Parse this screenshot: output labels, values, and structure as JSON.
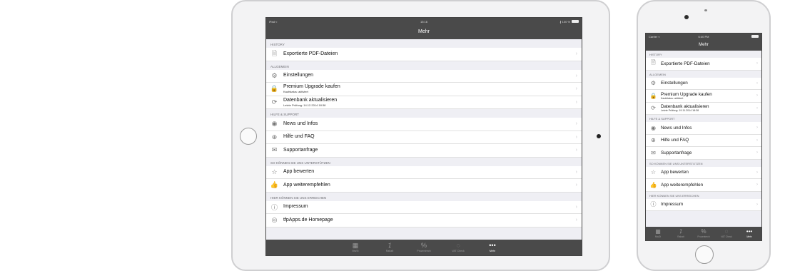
{
  "tablet": {
    "status": {
      "left": "iPad ≈",
      "time": "15:16",
      "right": "∦ 100 %"
    },
    "nav_title": "Mehr",
    "sections": [
      {
        "header": "HISTORY",
        "rows": [
          {
            "icon": "document-icon",
            "glyph": "🗎",
            "label": "Exportierte PDF-Dateien"
          }
        ]
      },
      {
        "header": "ALLGEMEIN",
        "rows": [
          {
            "icon": "gear-icon",
            "glyph": "⚙",
            "label": "Einstellungen"
          },
          {
            "icon": "lock-icon",
            "glyph": "🔒",
            "label": "Premium Upgrade kaufen",
            "sub": "Kaufstatus: aktiviert"
          },
          {
            "icon": "refresh-icon",
            "glyph": "⟳",
            "label": "Datenbank aktualisieren",
            "sub": "Letzte Prüfung: 14.12.2014 18:38"
          }
        ]
      },
      {
        "header": "HILFE & SUPPORT",
        "rows": [
          {
            "icon": "rss-icon",
            "glyph": "◉",
            "label": "News und Infos"
          },
          {
            "icon": "lifebuoy-icon",
            "glyph": "⊕",
            "label": "Hilfe und FAQ"
          },
          {
            "icon": "mail-icon",
            "glyph": "✉",
            "label": "Supportanfrage"
          }
        ]
      },
      {
        "header": "SO KÖNNEN SIE UNS UNTERSTÜTZEN",
        "rows": [
          {
            "icon": "star-icon",
            "glyph": "☆",
            "label": "App bewerten"
          },
          {
            "icon": "thumbs-up-icon",
            "glyph": "👍",
            "label": "App weiterempfehlen"
          }
        ]
      },
      {
        "header": "HIER KÖNNEN SIE UNS ERREICHEN",
        "rows": [
          {
            "icon": "info-icon",
            "glyph": "ⓘ",
            "label": "Impressum"
          },
          {
            "icon": "globe-icon",
            "glyph": "◎",
            "label": "tfpApps.de Homepage"
          }
        ]
      }
    ],
    "tabs": [
      {
        "icon": "calculator-icon",
        "glyph": "▦",
        "label": "MwSt"
      },
      {
        "icon": "discount-icon",
        "glyph": "⁒",
        "label": "Rabatt"
      },
      {
        "icon": "percent-icon",
        "glyph": "%",
        "label": "Prozentrech"
      },
      {
        "icon": "check-icon",
        "glyph": "◌",
        "label": "VAT Check"
      },
      {
        "icon": "more-icon",
        "glyph": "•••",
        "label": "Mehr",
        "active": true
      }
    ]
  },
  "phone": {
    "status": {
      "left": "Carrier ≈",
      "time": "6:40 PM",
      "right": ""
    },
    "nav_title": "Mehr",
    "sections": [
      {
        "header": "HISTORY",
        "rows": [
          {
            "icon": "document-icon",
            "glyph": "🗎",
            "label": "Exportierte PDF-Dateien"
          }
        ]
      },
      {
        "header": "ALLGEMEIN",
        "rows": [
          {
            "icon": "gear-icon",
            "glyph": "⚙",
            "label": "Einstellungen"
          },
          {
            "icon": "lock-icon",
            "glyph": "🔒",
            "label": "Premium Upgrade kaufen",
            "sub": "Kaufstatus: aktiviert"
          },
          {
            "icon": "refresh-icon",
            "glyph": "⟳",
            "label": "Datenbank aktualisieren",
            "sub": "Letzte Prüfung: 19.11.2014 18:38"
          }
        ]
      },
      {
        "header": "HILFE & SUPPORT",
        "rows": [
          {
            "icon": "rss-icon",
            "glyph": "◉",
            "label": "News und Infos"
          },
          {
            "icon": "lifebuoy-icon",
            "glyph": "⊕",
            "label": "Hilfe und FAQ"
          },
          {
            "icon": "mail-icon",
            "glyph": "✉",
            "label": "Supportanfrage"
          }
        ]
      },
      {
        "header": "SO KÖNNEN SIE UNS UNTERSTÜTZEN",
        "rows": [
          {
            "icon": "star-icon",
            "glyph": "☆",
            "label": "App bewerten"
          },
          {
            "icon": "thumbs-up-icon",
            "glyph": "👍",
            "label": "App weiterempfehlen"
          }
        ]
      },
      {
        "header": "HIER KÖNNEN SIE UNS ERREICHEN",
        "rows": [
          {
            "icon": "info-icon",
            "glyph": "ⓘ",
            "label": "Impressum"
          }
        ]
      }
    ],
    "tabs": [
      {
        "icon": "calculator-icon",
        "glyph": "▦",
        "label": "MwSt"
      },
      {
        "icon": "discount-icon",
        "glyph": "⁒",
        "label": "Rabatt"
      },
      {
        "icon": "percent-icon",
        "glyph": "%",
        "label": "Prozentrech"
      },
      {
        "icon": "check-icon",
        "glyph": "◌",
        "label": "VAT Check"
      },
      {
        "icon": "more-icon",
        "glyph": "•••",
        "label": "Mehr",
        "active": true
      }
    ]
  }
}
